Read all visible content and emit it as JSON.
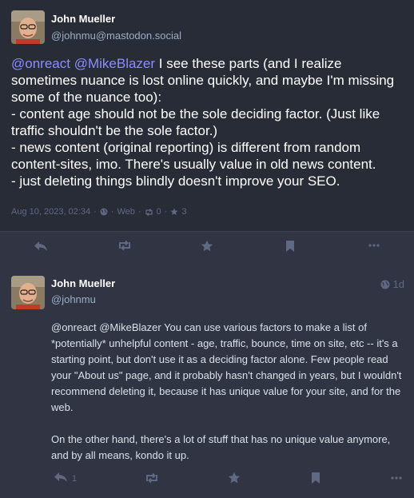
{
  "post1": {
    "author_name": "John Mueller",
    "author_handle": "@johnmu@mastodon.social",
    "mention1": "@onreact",
    "mention2": "@MikeBlazer",
    "text_after_mentions": " I see these parts (and I realize sometimes nuance is lost online quickly, and maybe I'm missing some of the nuance too):",
    "line2": "- content age should not be the sole deciding factor. (Just like traffic shouldn't be the sole factor.)",
    "line3": "- news content (original reporting) is different from random content-sites, imo. There's usually value in old news content.",
    "line4": "- just deleting things blindly doesn't improve your SEO.",
    "date": "Aug 10, 2023, 02:34",
    "sep": "·",
    "app": "Web",
    "boosts": "0",
    "favourites": "3"
  },
  "post2": {
    "author_name": "John Mueller",
    "author_handle": "@johnmu",
    "age": "1d",
    "mention1": "@onreact",
    "mention2": "@MikeBlazer",
    "para1_rest": "  You can use various factors to make a list of *potentially* unhelpful content - age, traffic, bounce, time on site, etc -- it's a starting point, but don't use it as a deciding factor alone. Few people read your \"About us\" page, and it probably hasn't changed in years, but I wouldn't recommend deleting it, because it has unique value for your site, and for the web.",
    "para2": "On the other hand, there's a lot of stuff that has no unique value anymore, and by all means, kondo it up.",
    "replies": "1"
  },
  "icons": {
    "reply": "reply-icon",
    "boost": "boost-icon",
    "favourite": "star-icon",
    "bookmark": "bookmark-icon",
    "more": "more-icon",
    "globe": "globe-icon"
  },
  "colors": {
    "background": "#282c37",
    "reply_background": "#313543",
    "mention": "#8c8dff",
    "muted": "#606984"
  }
}
